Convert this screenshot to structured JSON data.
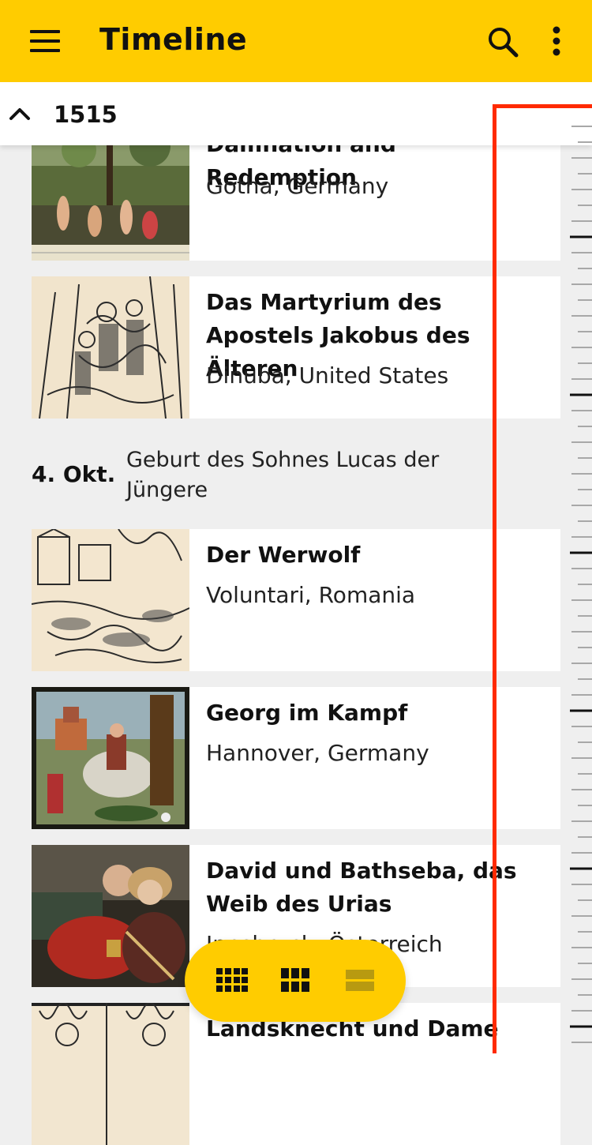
{
  "app_bar": {
    "title": "Timeline",
    "menu_icon": "hamburger-menu-icon",
    "search_icon": "search-icon",
    "more_icon": "more-vertical-icon",
    "background": "#ffcc00"
  },
  "year_header": {
    "year": "1515",
    "collapse_icon": "chevron-up-icon"
  },
  "items": [
    {
      "title": "Damnation and Redemption",
      "location": "Gotha, Germany"
    },
    {
      "title": "Das Martyrium des Apostels Jakobus des Älteren",
      "location": "Dinuba, United States"
    },
    {
      "title": "Der Werwolf",
      "location": "Voluntari, Romania"
    },
    {
      "title": "Georg im Kampf",
      "location": "Hannover, Germany"
    },
    {
      "title": "David und Bathseba, das Weib des Urias",
      "location": "Innsbruck, Österreich"
    },
    {
      "title": "Landsknecht und Dame",
      "location": ""
    }
  ],
  "event": {
    "date": "4. Okt.",
    "text": "Geburt des Sohnes Lucas der Jüngere"
  },
  "scrubber": {
    "highlight_color": "#ff2a00"
  },
  "view_switcher": {
    "options": [
      "grid-small-icon",
      "grid-large-icon",
      "list-icon"
    ],
    "selected": "list-icon"
  }
}
